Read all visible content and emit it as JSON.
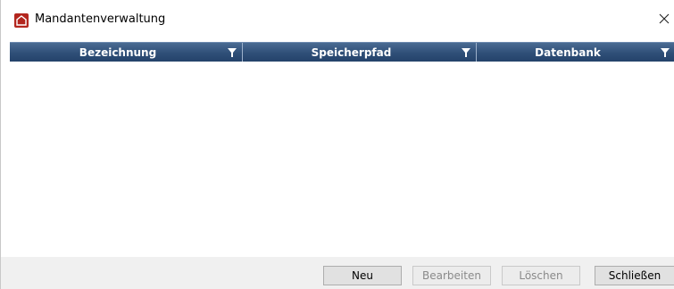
{
  "window": {
    "title": "Mandantenverwaltung",
    "icon": "home-icon",
    "accent_color": "#b3261e"
  },
  "grid": {
    "columns": [
      {
        "label": "Bezeichnung",
        "filter_icon": "filter-icon"
      },
      {
        "label": "Speicherpfad",
        "filter_icon": "filter-icon"
      },
      {
        "label": "Datenbank",
        "filter_icon": "filter-icon"
      }
    ],
    "rows": [],
    "header_color": "#2f4f78"
  },
  "footer": {
    "buttons": {
      "new": {
        "label": "Neu",
        "enabled": true
      },
      "edit": {
        "label": "Bearbeiten",
        "enabled": false
      },
      "delete": {
        "label": "Löschen",
        "enabled": false
      },
      "close": {
        "label": "Schließen",
        "enabled": true
      }
    }
  }
}
